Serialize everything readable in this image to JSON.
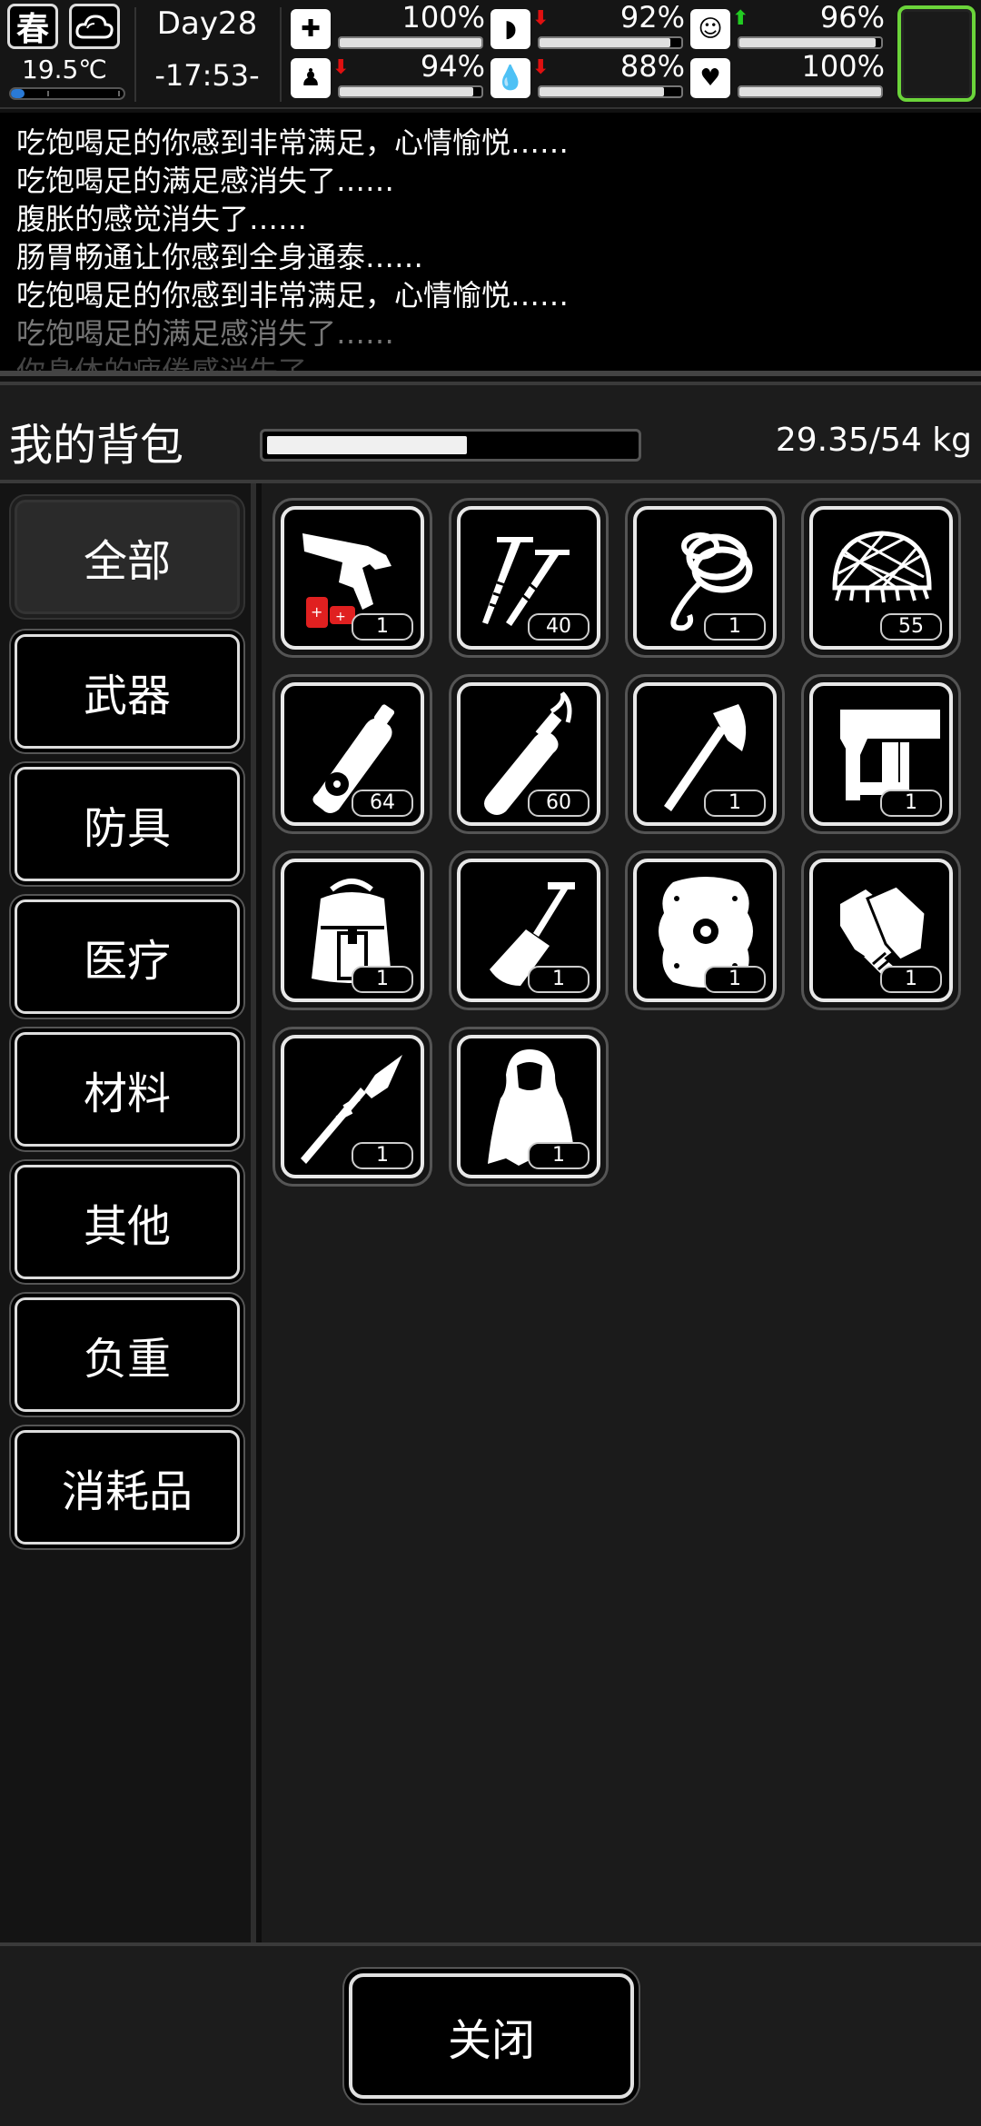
{
  "status": {
    "season": "春",
    "weather_icon": "cloud-icon",
    "temperature": "19.5℃",
    "temperature_level": 0.12,
    "day": "Day28",
    "clock": "-17:53-",
    "stats": [
      {
        "name": "health",
        "icon": "medkit-icon",
        "value": "100%",
        "level": 1.0,
        "trend": "none"
      },
      {
        "name": "hunger",
        "icon": "stomach-icon",
        "value": "92%",
        "level": 0.92,
        "trend": "down"
      },
      {
        "name": "mood",
        "icon": "face-icon",
        "value": "96%",
        "level": 0.96,
        "trend": "up"
      },
      {
        "name": "stamina",
        "icon": "foot-icon",
        "value": "94%",
        "level": 0.94,
        "trend": "down"
      },
      {
        "name": "thirst",
        "icon": "water-drop-icon",
        "value": "88%",
        "level": 0.88,
        "trend": "down"
      },
      {
        "name": "heart",
        "icon": "heart-icon",
        "value": "100%",
        "level": 1.0,
        "trend": "none"
      }
    ],
    "colors": {
      "trend_down": "#e01010",
      "trend_up": "#22cc22",
      "equip_border": "#6bd43a"
    }
  },
  "log": [
    "吃饱喝足的你感到非常满足，心情愉悦……",
    "吃饱喝足的满足感消失了……",
    "腹胀的感觉消失了……",
    "肠胃畅通让你感到全身通泰……",
    "吃饱喝足的你感到非常满足，心情愉悦……",
    "吃饱喝足的满足感消失了……",
    "你身体的疲倦感消失了"
  ],
  "backpack": {
    "title": "我的背包",
    "weight": "29.35/54 kg",
    "weight_fraction": 0.5435
  },
  "categories": [
    {
      "label": "全部",
      "active": true
    },
    {
      "label": "武器",
      "active": false
    },
    {
      "label": "防具",
      "active": false
    },
    {
      "label": "医疗",
      "active": false
    },
    {
      "label": "材料",
      "active": false
    },
    {
      "label": "其他",
      "active": false
    },
    {
      "label": "负重",
      "active": false
    },
    {
      "label": "消耗品",
      "active": false
    }
  ],
  "items": [
    {
      "icon": "flare-gun-icon",
      "count": "1"
    },
    {
      "icon": "spike-nails-icon",
      "count": "40"
    },
    {
      "icon": "rope-hook-icon",
      "count": "1"
    },
    {
      "icon": "net-icon",
      "count": "55"
    },
    {
      "icon": "gas-canister-icon",
      "count": "64"
    },
    {
      "icon": "molotov-icon",
      "count": "60"
    },
    {
      "icon": "axe-icon",
      "count": "1"
    },
    {
      "icon": "nail-gun-icon",
      "count": "1"
    },
    {
      "icon": "backpack-icon",
      "count": "1"
    },
    {
      "icon": "shovel-icon",
      "count": "1"
    },
    {
      "icon": "shield-icon",
      "count": "1"
    },
    {
      "icon": "gloves-icon",
      "count": "1"
    },
    {
      "icon": "spear-icon",
      "count": "1"
    },
    {
      "icon": "cloak-icon",
      "count": "1"
    }
  ],
  "close_label": "关闭"
}
